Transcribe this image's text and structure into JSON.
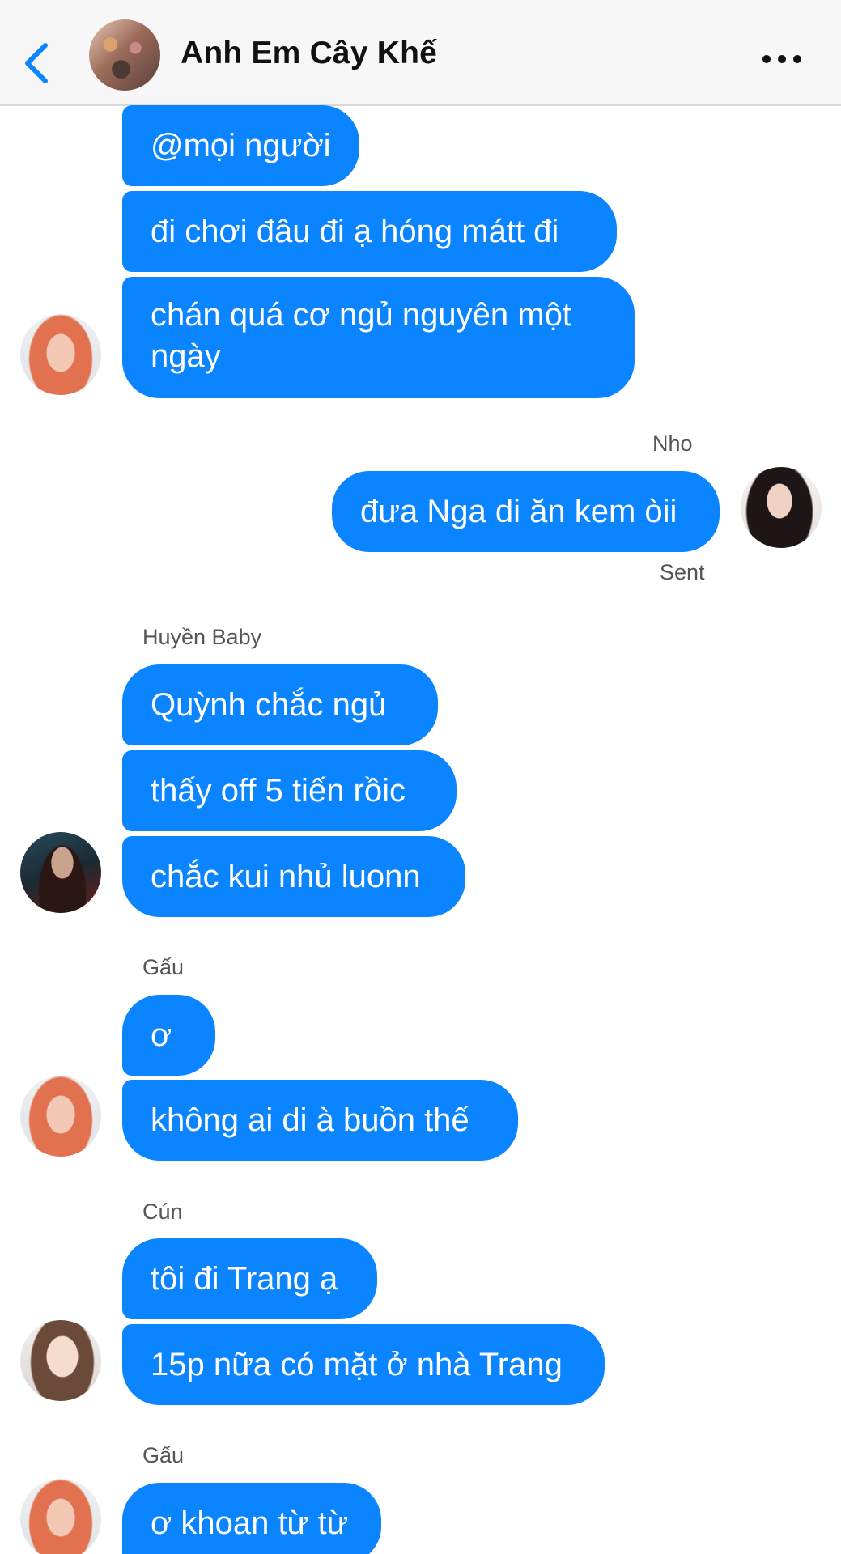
{
  "header": {
    "title": "Anh Em Cây Khế",
    "back_icon": "chevron-left-icon",
    "more_icon": "more-horizontal-icon",
    "accent": "#0a84ff"
  },
  "messages": {
    "m1": "@mọi người",
    "m2": "đi chơi đâu đi ạ hóng mátt đi",
    "m3_line1": "chán quá cơ ngủ nguyên một",
    "m3_line2": "ngày",
    "nho_name": "Nho",
    "m4": "đưa Nga di ăn kem òii",
    "sent_status": "Sent",
    "huyen_name": "Huyền Baby",
    "m5": "Quỳnh chắc ngủ",
    "m6": "thấy off 5 tiến rồic",
    "m7": "chắc kui nhủ luonn",
    "gau_name": "Gấu",
    "m8": "ơ",
    "m9": "không ai di à buồn thế",
    "cun_name": "Cún",
    "m10": "tôi đi Trang ạ",
    "m11": "15p nữa có mặt ở nhà Trang",
    "gau_name_2": "Gấu",
    "m12": "ơ khoan từ từ"
  },
  "colors": {
    "bubble": "#0a84ff",
    "bubble_text": "#ffffff",
    "header_bg": "#f7f7f7"
  }
}
